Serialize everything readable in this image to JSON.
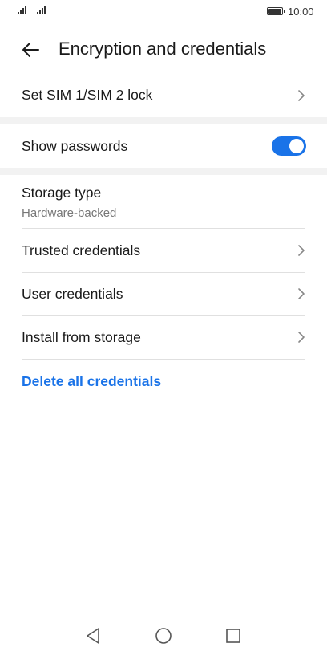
{
  "status_bar": {
    "time": "10:00",
    "icons": [
      "signal-icon",
      "signal-icon",
      "battery-icon"
    ]
  },
  "header": {
    "title": "Encryption and credentials",
    "back_icon": "arrow-left-icon"
  },
  "sections": {
    "sim_lock": {
      "label": "Set SIM 1/SIM 2 lock"
    },
    "show_passwords": {
      "label": "Show passwords",
      "enabled": true
    },
    "storage_type": {
      "label": "Storage type",
      "value": "Hardware-backed"
    },
    "trusted": {
      "label": "Trusted credentials"
    },
    "user": {
      "label": "User credentials"
    },
    "install": {
      "label": "Install from storage"
    },
    "delete_all": {
      "label": "Delete all credentials"
    }
  },
  "nav_bar": {
    "buttons": [
      "back-triangle-icon",
      "home-circle-icon",
      "recents-square-icon"
    ]
  },
  "colors": {
    "accent": "#1a73e8",
    "text": "#1a1a1a",
    "secondary_text": "#777777",
    "divider": "#e0e0e0",
    "band": "#f2f2f2"
  }
}
